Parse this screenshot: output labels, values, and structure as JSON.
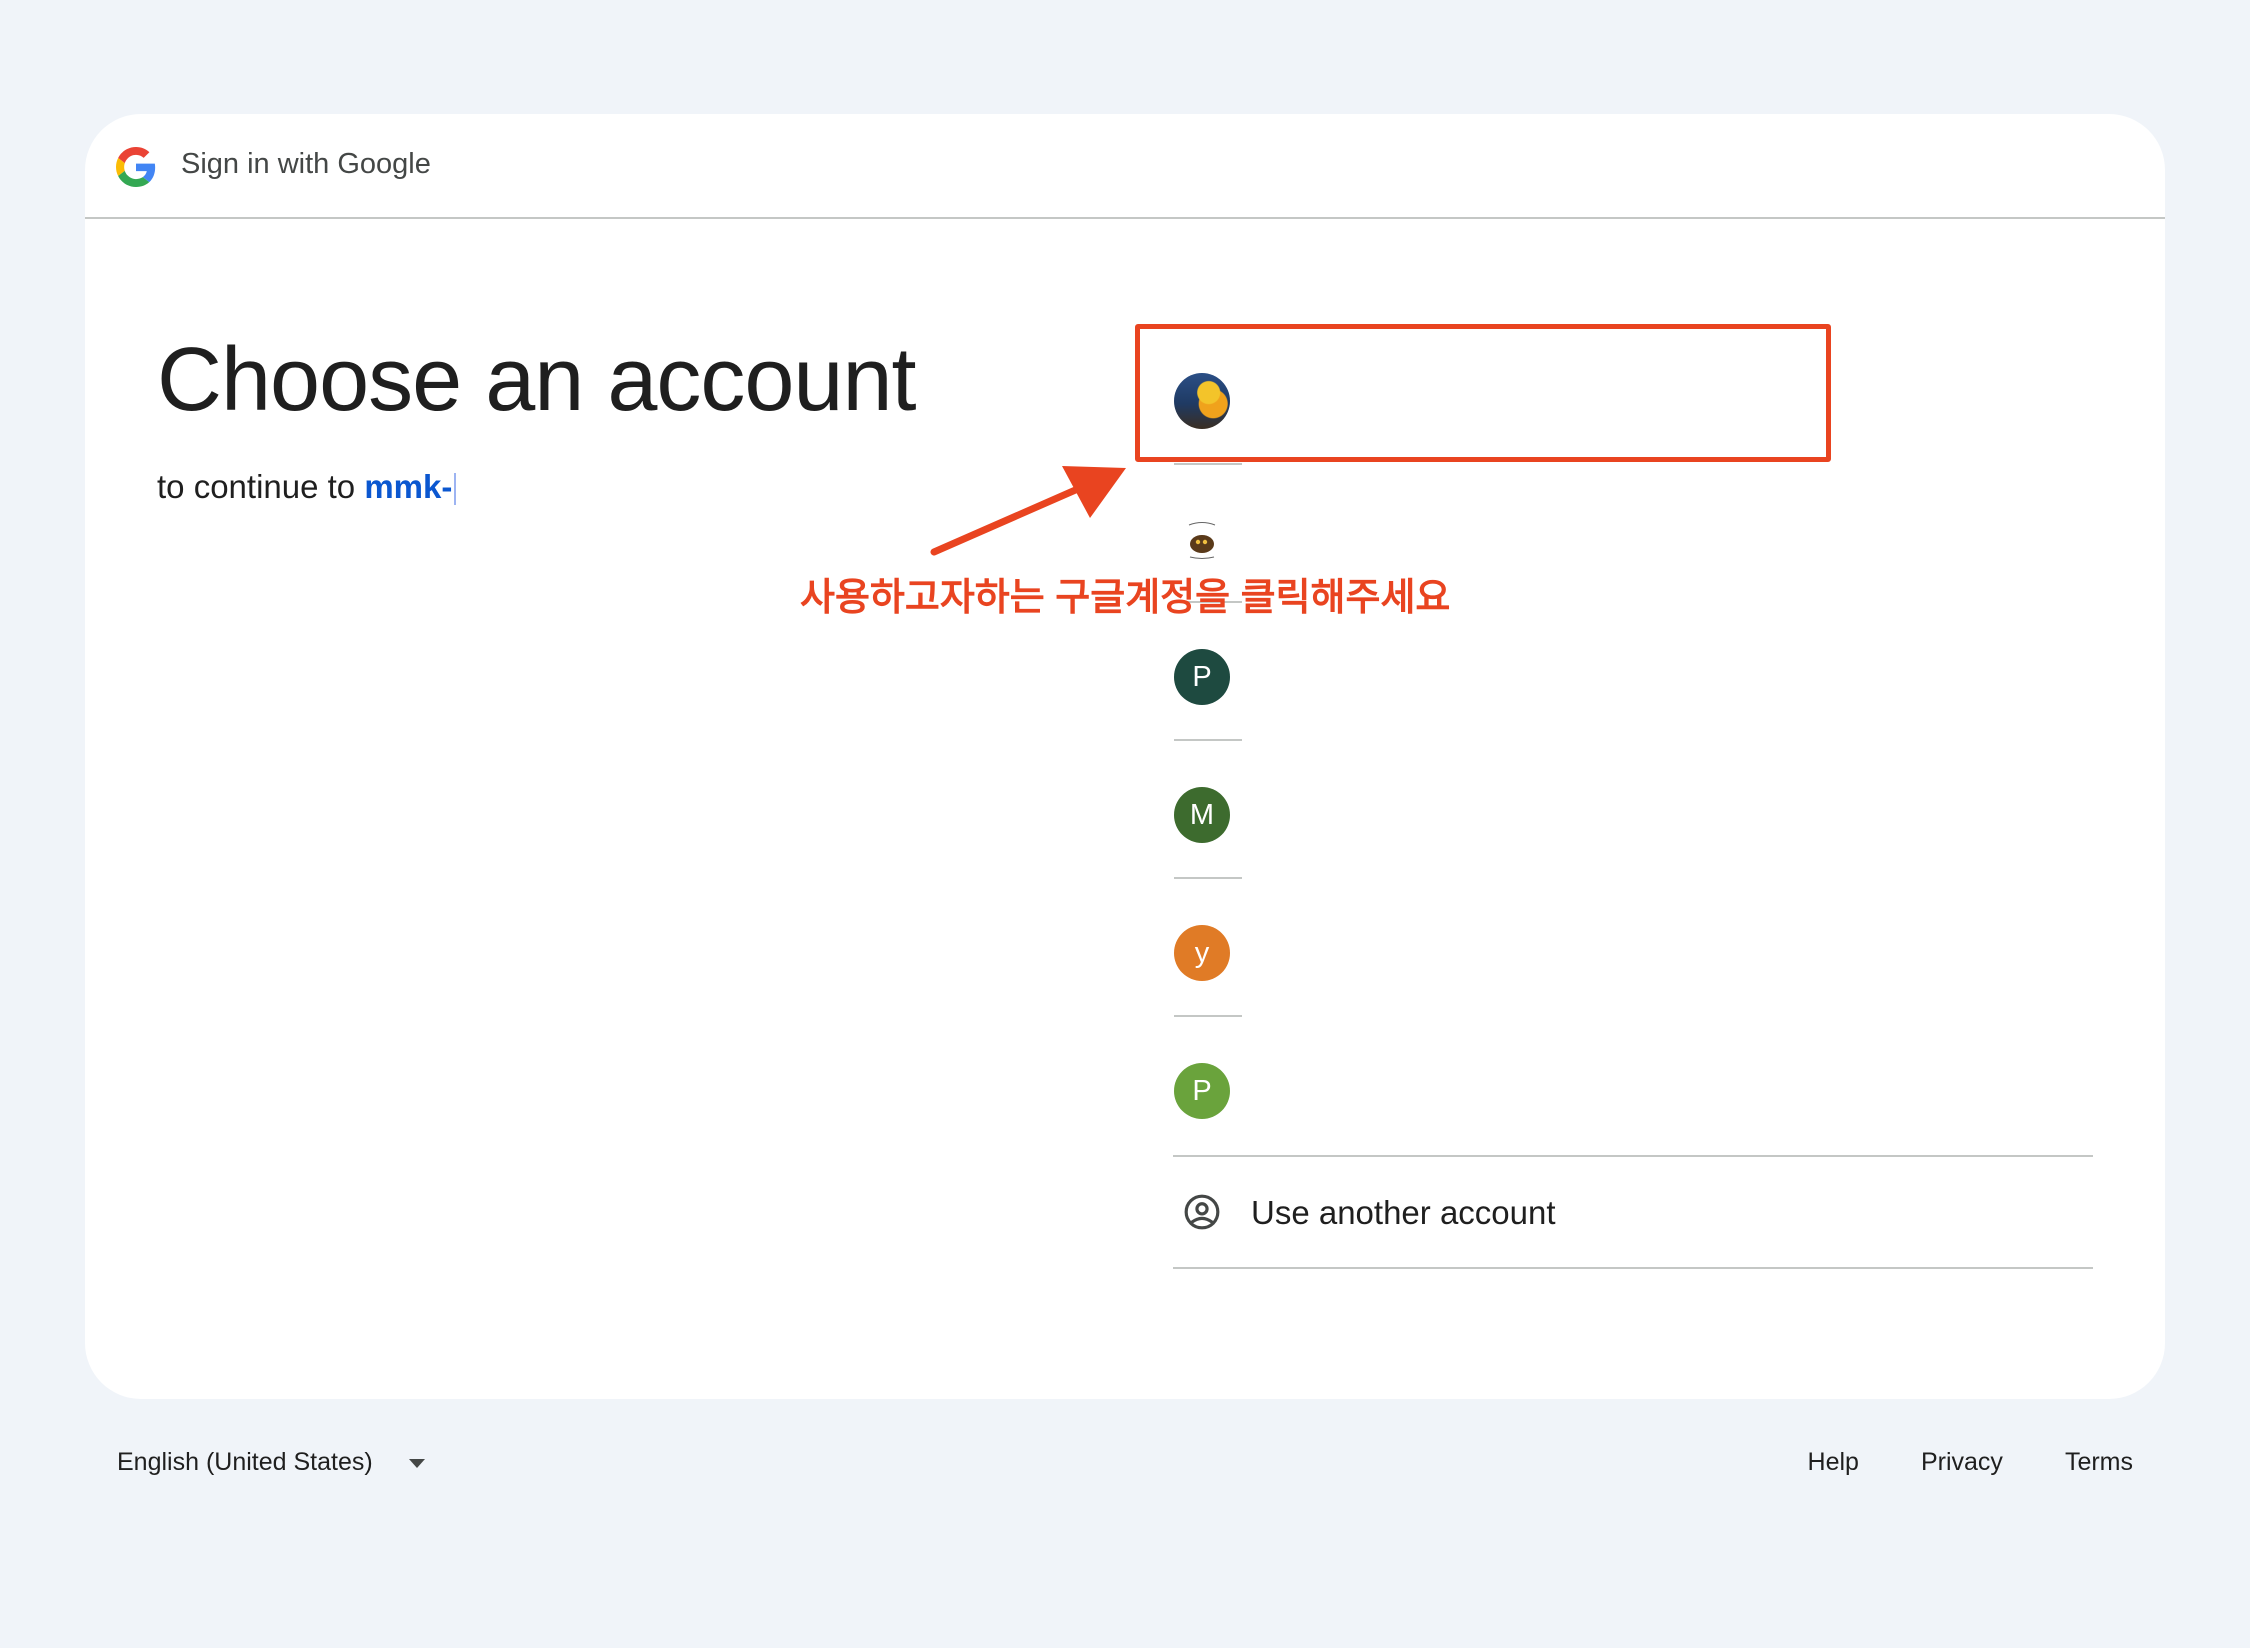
{
  "header": {
    "title": "Sign in with Google",
    "logo_icon": "google-g-icon"
  },
  "main": {
    "heading": "Choose an account",
    "subtitle_prefix": "to continue to ",
    "subtitle_app": "mmk-"
  },
  "accounts": [
    {
      "avatar_type": "photo",
      "initial": ""
    },
    {
      "avatar_type": "photo",
      "initial": ""
    },
    {
      "avatar_type": "letter",
      "initial": "P",
      "color": "#1e4a40"
    },
    {
      "avatar_type": "letter",
      "initial": "M",
      "color": "#3d6b2e"
    },
    {
      "avatar_type": "letter",
      "initial": "y",
      "color": "#e07b26"
    },
    {
      "avatar_type": "letter",
      "initial": "P",
      "color": "#6aa33c"
    }
  ],
  "use_another": {
    "label": "Use another account",
    "icon": "account-circle-icon"
  },
  "annotation": {
    "text": "사용하고자하는 구글계정을 클릭해주세요",
    "color": "#e94420"
  },
  "footer": {
    "language": "English (United States)",
    "links": {
      "help": "Help",
      "privacy": "Privacy",
      "terms": "Terms"
    }
  }
}
